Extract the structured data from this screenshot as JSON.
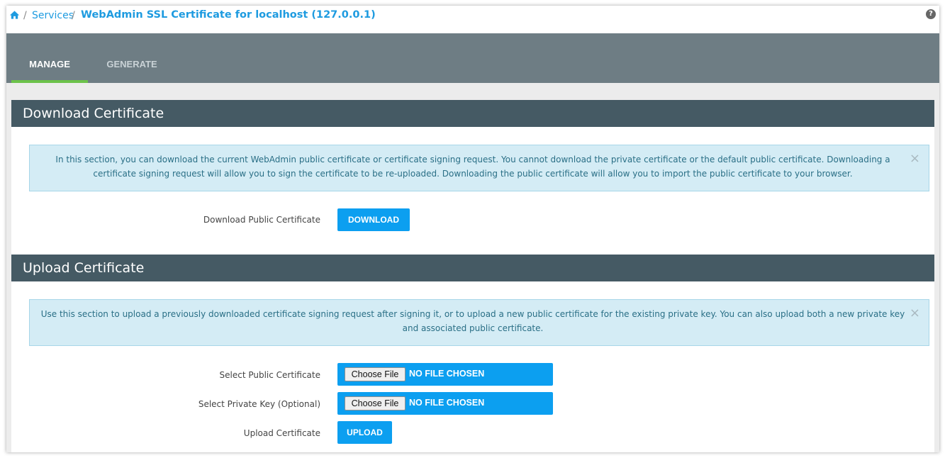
{
  "breadcrumb": {
    "home_icon": "home-icon",
    "separator": "/",
    "services": "Services",
    "current": "WebAdmin SSL Certificate for localhost (127.0.0.1)",
    "help_icon_glyph": "?"
  },
  "tabs": [
    {
      "label": "MANAGE",
      "active": true
    },
    {
      "label": "GENERATE",
      "active": false
    }
  ],
  "download_section": {
    "title": "Download Certificate",
    "info": "In this section, you can download the current WebAdmin public certificate or certificate signing request. You cannot download the private certificate or the default public certificate. Downloading a certificate signing request will allow you to sign the certificate to be re-uploaded. Downloading the public certificate will allow you to import the public certificate to your browser.",
    "close_glyph": "×",
    "field_label": "Download Public Certificate",
    "button": "DOWNLOAD"
  },
  "upload_section": {
    "title": "Upload Certificate",
    "info": "Use this section to upload a previously downloaded certificate signing request after signing it, or to upload a new public certificate for the existing private key. You can also upload both a new private key and associated public certificate.",
    "close_glyph": "×",
    "public_cert_label": "Select Public Certificate",
    "private_key_label": "Select Private Key (Optional)",
    "upload_label": "Upload Certificate",
    "choose_file": "Choose File",
    "no_file": "NO FILE CHOSEN",
    "upload_button": "UPLOAD"
  },
  "colors": {
    "accent": "#0c9ff0",
    "link": "#1e9be0",
    "tab_bar": "#6e7d84",
    "active_tab_indicator": "#6cc24a",
    "section_header": "#455a64",
    "info_bg": "#d4ecf5"
  }
}
